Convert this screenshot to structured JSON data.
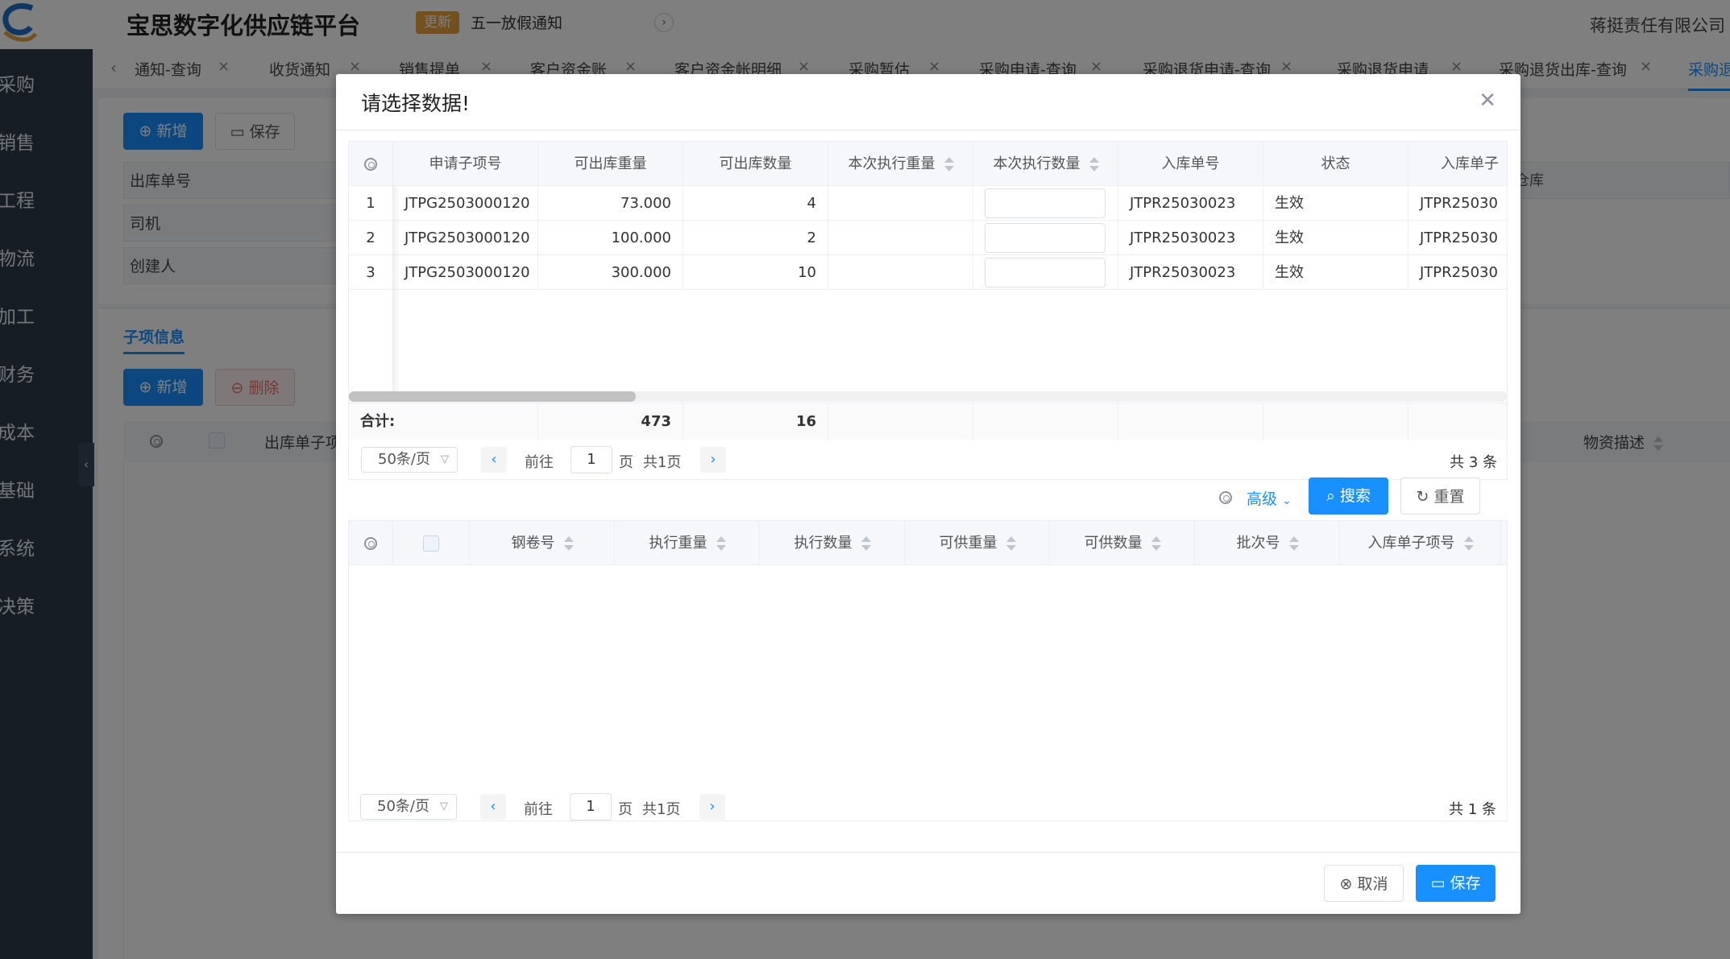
{
  "app": {
    "title": "宝思数字化供应链平台",
    "update_badge": "更新",
    "notice": "五一放假通知",
    "company": "蒋挺责任有限公司"
  },
  "sidebar": {
    "items": [
      "采购",
      "销售",
      "工程",
      "物流",
      "加工",
      "财务",
      "成本",
      "基础",
      "系统",
      "决策"
    ]
  },
  "tabs": [
    "通知-查询",
    "收货通知",
    "销售提单",
    "客户资金账",
    "客户资金帐明细",
    "采购暂估",
    "采购申请-查询",
    "采购退货申请-查询",
    "采购退货申请",
    "采购退货出库-查询",
    "采购退"
  ],
  "background_form": {
    "add_label": "新增",
    "save_label": "保存",
    "fields": [
      "出库单号",
      "司机",
      "创建人"
    ],
    "store_label": "仓库",
    "section_title": "子项信息",
    "sub_add_label": "新增",
    "sub_delete_label": "删除",
    "grid_col_first": "出库单子项",
    "grid_col_last": "物资描述"
  },
  "dialog": {
    "title": "请选择数据!",
    "top_grid": {
      "columns": [
        "申请子项号",
        "可出库重量",
        "可出库数量",
        "本次执行重量",
        "本次执行数量",
        "入库单号",
        "状态",
        "入库单子"
      ],
      "rows": [
        {
          "idx": "1",
          "apply_item": "JTPG2503000120",
          "weight": "73.000",
          "qty": "4",
          "in_no": "JTPR25030023",
          "status": "生效",
          "in_item": "JTPR25030"
        },
        {
          "idx": "2",
          "apply_item": "JTPG2503000120",
          "weight": "100.000",
          "qty": "2",
          "in_no": "JTPR25030023",
          "status": "生效",
          "in_item": "JTPR25030"
        },
        {
          "idx": "3",
          "apply_item": "JTPG2503000120",
          "weight": "300.000",
          "qty": "10",
          "in_no": "JTPR25030023",
          "status": "生效",
          "in_item": "JTPR25030"
        }
      ],
      "sum_label": "合计:",
      "sum_weight": "473",
      "sum_qty": "16"
    },
    "top_pager": {
      "page_size": "50条/页",
      "goto_label": "前往",
      "page": "1",
      "page_unit": "页",
      "pages": "共1页",
      "total": "共 3 条"
    },
    "search": {
      "advanced_label": "高级",
      "search_label": "搜索",
      "reset_label": "重置"
    },
    "bottom_grid": {
      "columns": [
        "钢卷号",
        "执行重量",
        "执行数量",
        "可供重量",
        "可供数量",
        "批次号",
        "入库单子项号"
      ]
    },
    "bottom_pager": {
      "page_size": "50条/页",
      "goto_label": "前往",
      "page": "1",
      "page_unit": "页",
      "pages": "共1页",
      "total": "共 1 条"
    },
    "footer": {
      "cancel_label": "取消",
      "save_label": "保存"
    }
  },
  "colors": {
    "primary": "#1890ff",
    "sidebar": "#2d3a4b",
    "badge": "#e6a23c",
    "danger": "#f56c6c"
  }
}
